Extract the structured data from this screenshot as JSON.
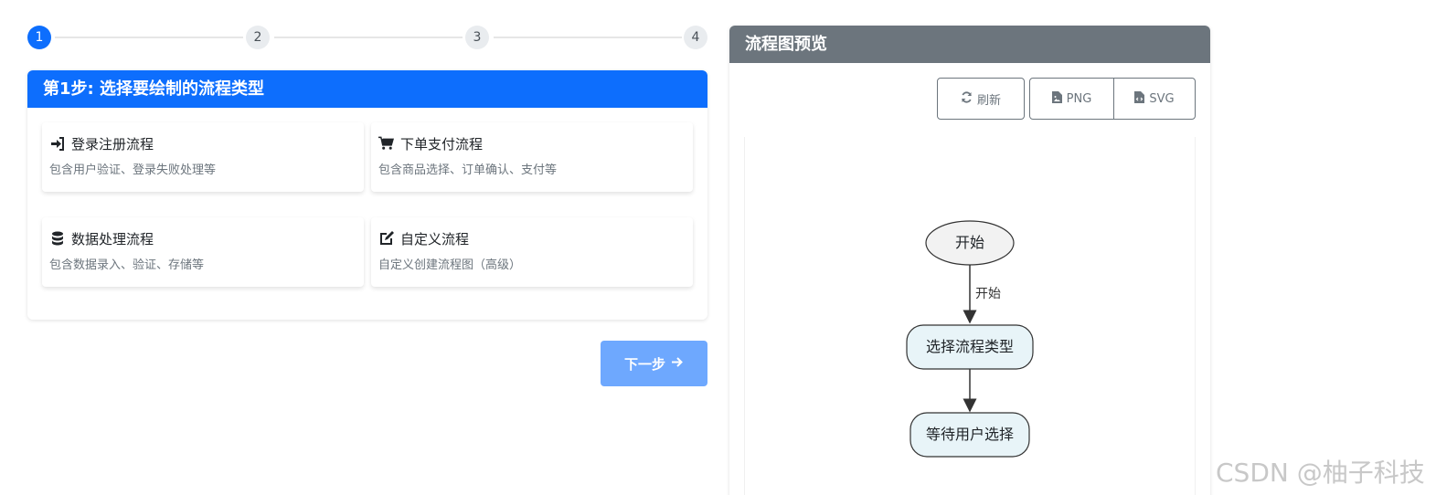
{
  "stepper": {
    "steps": [
      "1",
      "2",
      "3",
      "4"
    ],
    "active_step": 1
  },
  "step_card": {
    "title": "第1步: 选择要绘制的流程类型",
    "options": [
      {
        "icon": "sign-in-icon",
        "title": "登录注册流程",
        "desc": "包含用户验证、登录失败处理等"
      },
      {
        "icon": "cart-icon",
        "title": "下单支付流程",
        "desc": "包含商品选择、订单确认、支付等"
      },
      {
        "icon": "database-icon",
        "title": "数据处理流程",
        "desc": "包含数据录入、验证、存储等"
      },
      {
        "icon": "edit-icon",
        "title": "自定义流程",
        "desc": "自定义创建流程图（高级）"
      }
    ]
  },
  "next_button": {
    "label": "下一步"
  },
  "preview": {
    "title": "流程图预览",
    "buttons": {
      "refresh": "刷新",
      "png": "PNG",
      "svg": "SVG"
    }
  },
  "flowchart": {
    "nodes": [
      {
        "id": "start",
        "label": "开始",
        "shape": "ellipse"
      },
      {
        "id": "select",
        "label": "选择流程类型",
        "shape": "rounded"
      },
      {
        "id": "wait",
        "label": "等待用户选择",
        "shape": "rounded"
      }
    ],
    "edges": [
      {
        "from": "start",
        "to": "select",
        "label": "开始"
      },
      {
        "from": "select",
        "to": "wait",
        "label": ""
      }
    ],
    "colors": {
      "node_fill_start": "#f2f2f2",
      "node_fill": "#e8f4f8",
      "stroke": "#333333"
    }
  },
  "watermark": "CSDN @柚子科技",
  "colors": {
    "primary": "#0d6efd",
    "secondary": "#6c757d",
    "next_disabled": "#6ea8fe"
  }
}
